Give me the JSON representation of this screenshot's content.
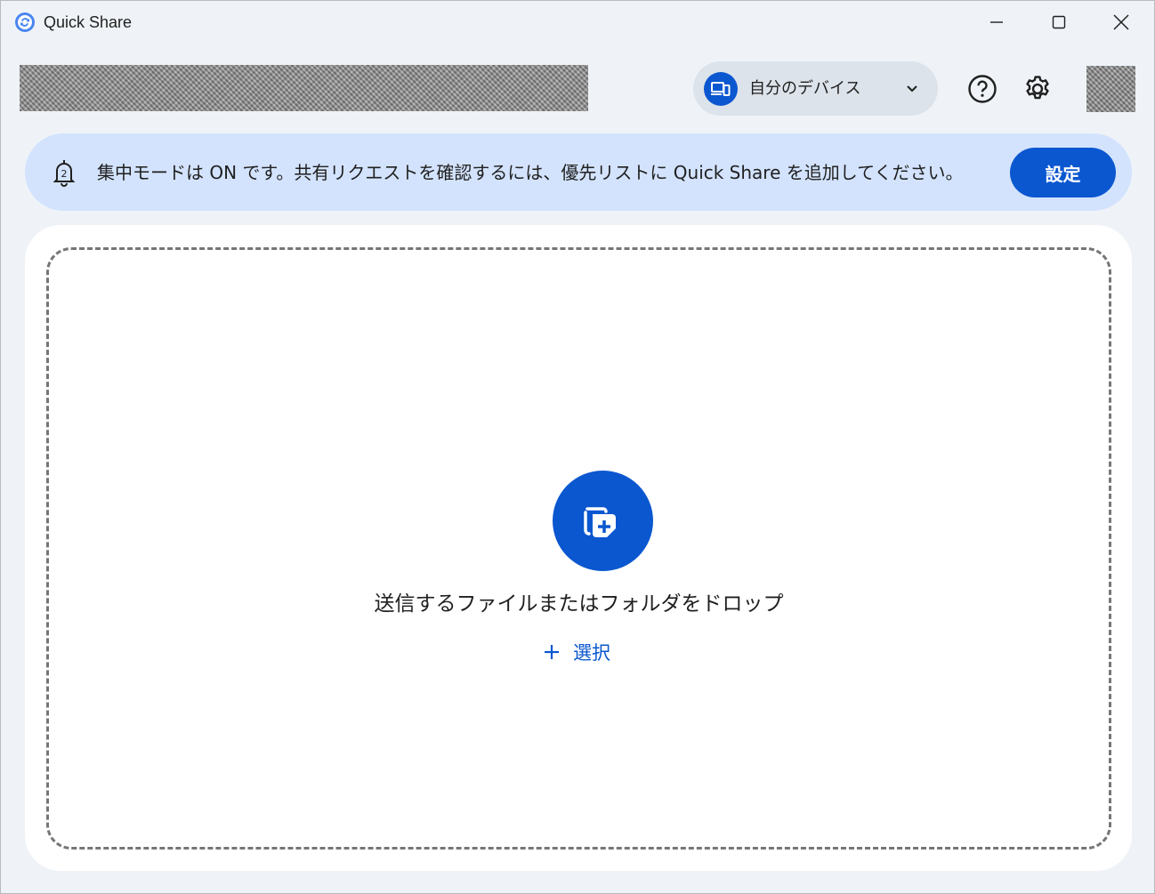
{
  "window": {
    "title": "Quick Share",
    "controls": [
      "minimize",
      "maximize",
      "close"
    ]
  },
  "header": {
    "device_selector": {
      "label": "自分のデバイス",
      "icon": "devices-icon"
    },
    "help_icon": "help-circle-icon",
    "settings_icon": "gear-icon"
  },
  "banner": {
    "text": "集中モードは ON です。共有リクエストを確認するには、優先リストに Quick Share を追加してください。",
    "button_label": "設定",
    "icon": "do-not-disturb-bell-icon"
  },
  "dropzone": {
    "text": "送信するファイルまたはフォルダをドロップ",
    "select_label": "選択",
    "icon": "add-files-icon"
  },
  "colors": {
    "accent": "#0b57d0",
    "banner_bg": "#d3e3fd",
    "window_bg": "#eff3f8",
    "chip_bg": "#dde3ea"
  }
}
